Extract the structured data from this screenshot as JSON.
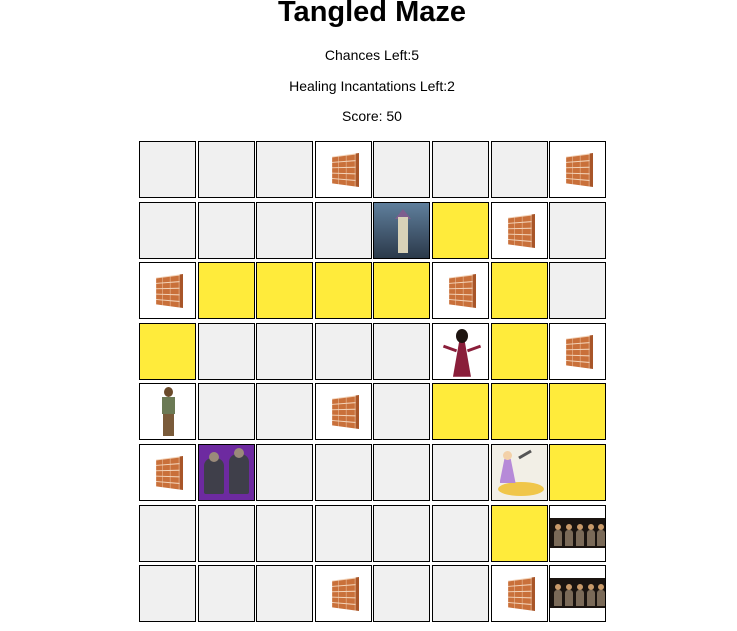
{
  "title": "Tangled Maze",
  "stats": {
    "chances": "Chances Left:5",
    "healing": "Healing Incantations Left:2",
    "score": "Score: 50"
  },
  "colors": {
    "empty": "#f0f0f0",
    "path": "#ffeb3b",
    "border": "#000000"
  },
  "board": {
    "rows": 8,
    "cols": 8,
    "cells": [
      [
        "empty",
        "empty",
        "empty",
        "wall",
        "empty",
        "empty",
        "empty",
        "wall"
      ],
      [
        "empty",
        "empty",
        "empty",
        "empty",
        "tower",
        "path",
        "wall",
        "empty"
      ],
      [
        "wall",
        "path",
        "path",
        "path",
        "path",
        "wall",
        "path",
        "empty"
      ],
      [
        "path",
        "empty",
        "empty",
        "empty",
        "empty",
        "gothel",
        "path",
        "wall"
      ],
      [
        "flynn",
        "empty",
        "empty",
        "wall",
        "empty",
        "path",
        "path",
        "path"
      ],
      [
        "wall",
        "thugs",
        "empty",
        "empty",
        "empty",
        "empty",
        "rapunzel",
        "path"
      ],
      [
        "empty",
        "empty",
        "empty",
        "empty",
        "empty",
        "empty",
        "path",
        "guards"
      ],
      [
        "empty",
        "empty",
        "empty",
        "wall",
        "empty",
        "empty",
        "wall",
        "guards"
      ]
    ]
  }
}
